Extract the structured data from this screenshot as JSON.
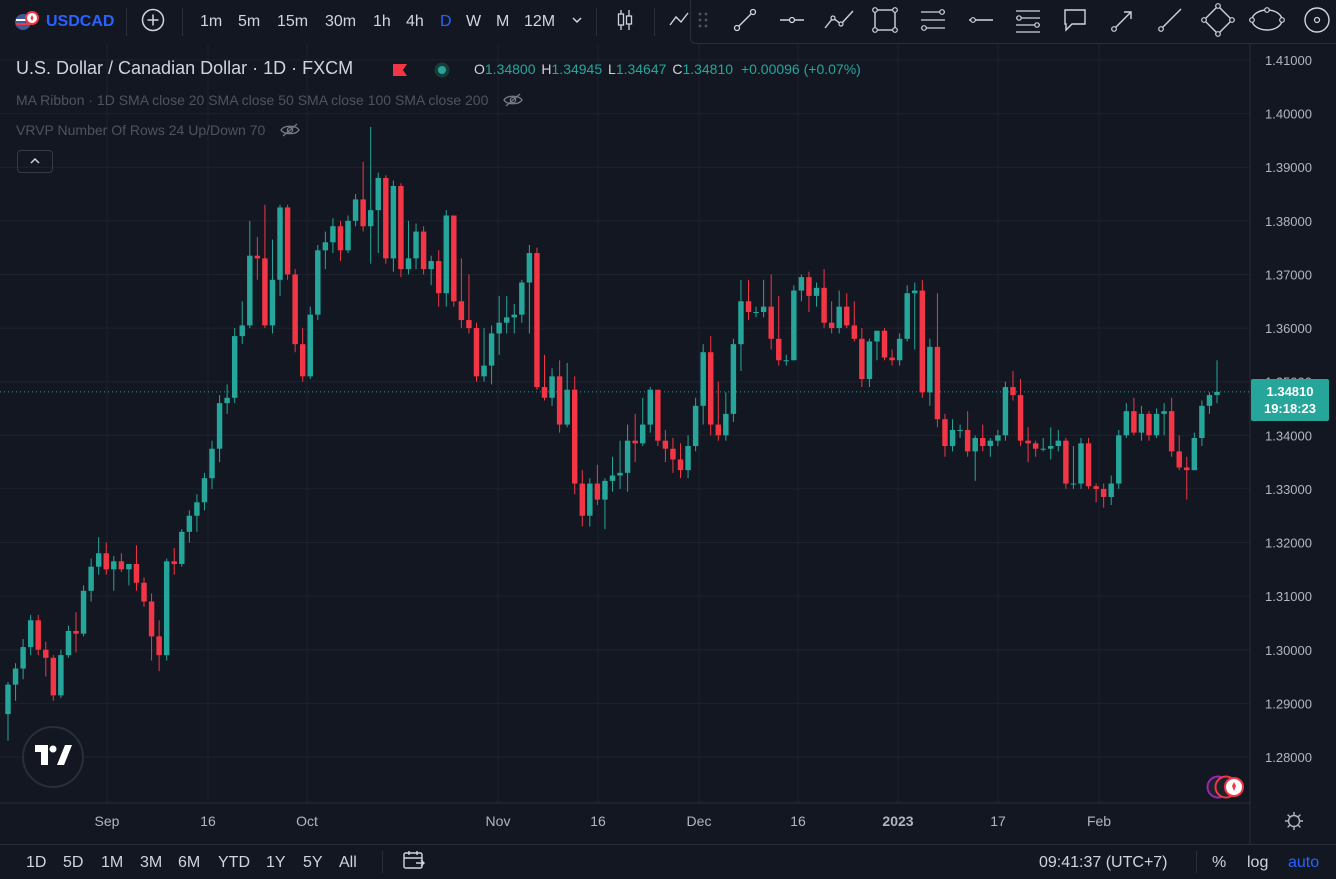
{
  "topbar": {
    "symbol": "USDCAD",
    "intervals": [
      "1m",
      "5m",
      "15m",
      "30m",
      "1h",
      "4h",
      "D",
      "W",
      "M",
      "12M"
    ],
    "active_interval": "D"
  },
  "legend": {
    "title": "U.S. Dollar / Canadian Dollar · 1D · FXCM",
    "o_label": "O",
    "o_value": "1.34800",
    "h_label": "H",
    "h_value": "1.34945",
    "l_label": "L",
    "l_value": "1.34647",
    "c_label": "C",
    "c_value": "1.34810",
    "change": "+0.00096 (+0.07%)",
    "indicators": [
      {
        "name": "MA Ribbon",
        "params": "· 1D SMA close 20 SMA close 50 SMA close 100 SMA close 200"
      },
      {
        "name": "VRVP",
        "params": "Number Of Rows 24 Up/Down 70"
      }
    ]
  },
  "price_axis": {
    "labels": [
      "1.41000",
      "1.40000",
      "1.39000",
      "1.38000",
      "1.37000",
      "1.36000",
      "1.35000",
      "1.34000",
      "1.33000",
      "1.32000",
      "1.31000",
      "1.30000",
      "1.29000",
      "1.28000"
    ],
    "current_price": "1.34810",
    "countdown": "19:18:23"
  },
  "time_axis": {
    "labels": [
      {
        "text": "Sep",
        "bold": false
      },
      {
        "text": "16",
        "bold": false
      },
      {
        "text": "Oct",
        "bold": false
      },
      {
        "text": "Nov",
        "bold": false
      },
      {
        "text": "16",
        "bold": false
      },
      {
        "text": "Dec",
        "bold": false
      },
      {
        "text": "16",
        "bold": false
      },
      {
        "text": "2023",
        "bold": true
      },
      {
        "text": "17",
        "bold": false
      },
      {
        "text": "Feb",
        "bold": false
      }
    ]
  },
  "bottombar": {
    "ranges": [
      "1D",
      "5D",
      "1M",
      "3M",
      "6M",
      "YTD",
      "1Y",
      "5Y",
      "All"
    ],
    "clock": "09:41:37 (UTC+7)",
    "percent_label": "%",
    "log_label": "log",
    "auto_label": "auto"
  },
  "colors": {
    "up": "#26a69a",
    "down": "#f23645",
    "accent": "#2962ff",
    "background": "#131722"
  },
  "chart_data": {
    "type": "candlestick",
    "symbol": "USDCAD",
    "interval": "1D",
    "ylim": [
      1.2715,
      1.4145
    ],
    "candles": [
      {
        "o": 1.288,
        "h": 1.294,
        "l": 1.283,
        "c": 1.2935
      },
      {
        "o": 1.2935,
        "h": 1.2975,
        "l": 1.2905,
        "c": 1.2965
      },
      {
        "o": 1.2965,
        "h": 1.302,
        "l": 1.2945,
        "c": 1.3005
      },
      {
        "o": 1.3005,
        "h": 1.3065,
        "l": 1.299,
        "c": 1.3055
      },
      {
        "o": 1.3055,
        "h": 1.3065,
        "l": 1.299,
        "c": 1.3
      },
      {
        "o": 1.3,
        "h": 1.3015,
        "l": 1.295,
        "c": 1.2985
      },
      {
        "o": 1.2985,
        "h": 1.299,
        "l": 1.2905,
        "c": 1.2915
      },
      {
        "o": 1.2915,
        "h": 1.3,
        "l": 1.291,
        "c": 1.299
      },
      {
        "o": 1.299,
        "h": 1.3045,
        "l": 1.2985,
        "c": 1.3035
      },
      {
        "o": 1.3035,
        "h": 1.307,
        "l": 1.2995,
        "c": 1.303
      },
      {
        "o": 1.303,
        "h": 1.312,
        "l": 1.3025,
        "c": 1.311
      },
      {
        "o": 1.311,
        "h": 1.317,
        "l": 1.309,
        "c": 1.3155
      },
      {
        "o": 1.3155,
        "h": 1.321,
        "l": 1.314,
        "c": 1.318
      },
      {
        "o": 1.318,
        "h": 1.32,
        "l": 1.314,
        "c": 1.315
      },
      {
        "o": 1.315,
        "h": 1.3175,
        "l": 1.311,
        "c": 1.3165
      },
      {
        "o": 1.3165,
        "h": 1.318,
        "l": 1.3145,
        "c": 1.315
      },
      {
        "o": 1.315,
        "h": 1.316,
        "l": 1.312,
        "c": 1.316
      },
      {
        "o": 1.316,
        "h": 1.3195,
        "l": 1.311,
        "c": 1.3125
      },
      {
        "o": 1.3125,
        "h": 1.3135,
        "l": 1.308,
        "c": 1.309
      },
      {
        "o": 1.309,
        "h": 1.3105,
        "l": 1.298,
        "c": 1.3025
      },
      {
        "o": 1.3025,
        "h": 1.3055,
        "l": 1.296,
        "c": 1.299
      },
      {
        "o": 1.299,
        "h": 1.317,
        "l": 1.298,
        "c": 1.3165
      },
      {
        "o": 1.3165,
        "h": 1.319,
        "l": 1.314,
        "c": 1.316
      },
      {
        "o": 1.316,
        "h": 1.3225,
        "l": 1.3155,
        "c": 1.322
      },
      {
        "o": 1.322,
        "h": 1.326,
        "l": 1.32,
        "c": 1.325
      },
      {
        "o": 1.325,
        "h": 1.329,
        "l": 1.322,
        "c": 1.3275
      },
      {
        "o": 1.3275,
        "h": 1.333,
        "l": 1.326,
        "c": 1.332
      },
      {
        "o": 1.332,
        "h": 1.339,
        "l": 1.33,
        "c": 1.3375
      },
      {
        "o": 1.3375,
        "h": 1.3475,
        "l": 1.335,
        "c": 1.346
      },
      {
        "o": 1.346,
        "h": 1.3495,
        "l": 1.344,
        "c": 1.347
      },
      {
        "o": 1.347,
        "h": 1.36,
        "l": 1.346,
        "c": 1.3585
      },
      {
        "o": 1.3585,
        "h": 1.365,
        "l": 1.357,
        "c": 1.3605
      },
      {
        "o": 1.3605,
        "h": 1.38,
        "l": 1.36,
        "c": 1.3735
      },
      {
        "o": 1.3735,
        "h": 1.377,
        "l": 1.369,
        "c": 1.373
      },
      {
        "o": 1.373,
        "h": 1.383,
        "l": 1.36,
        "c": 1.3605
      },
      {
        "o": 1.3605,
        "h": 1.3765,
        "l": 1.359,
        "c": 1.369
      },
      {
        "o": 1.369,
        "h": 1.383,
        "l": 1.366,
        "c": 1.3825
      },
      {
        "o": 1.3825,
        "h": 1.383,
        "l": 1.369,
        "c": 1.37
      },
      {
        "o": 1.37,
        "h": 1.371,
        "l": 1.3555,
        "c": 1.357
      },
      {
        "o": 1.357,
        "h": 1.36,
        "l": 1.35,
        "c": 1.351
      },
      {
        "o": 1.351,
        "h": 1.364,
        "l": 1.3505,
        "c": 1.3625
      },
      {
        "o": 1.3625,
        "h": 1.3755,
        "l": 1.3615,
        "c": 1.3745
      },
      {
        "o": 1.3745,
        "h": 1.378,
        "l": 1.371,
        "c": 1.376
      },
      {
        "o": 1.376,
        "h": 1.3805,
        "l": 1.374,
        "c": 1.379
      },
      {
        "o": 1.379,
        "h": 1.38,
        "l": 1.3725,
        "c": 1.3745
      },
      {
        "o": 1.3745,
        "h": 1.381,
        "l": 1.374,
        "c": 1.38
      },
      {
        "o": 1.38,
        "h": 1.385,
        "l": 1.379,
        "c": 1.384
      },
      {
        "o": 1.384,
        "h": 1.391,
        "l": 1.378,
        "c": 1.379
      },
      {
        "o": 1.379,
        "h": 1.3975,
        "l": 1.372,
        "c": 1.382
      },
      {
        "o": 1.382,
        "h": 1.389,
        "l": 1.374,
        "c": 1.388
      },
      {
        "o": 1.388,
        "h": 1.3885,
        "l": 1.372,
        "c": 1.373
      },
      {
        "o": 1.373,
        "h": 1.3875,
        "l": 1.3705,
        "c": 1.3865
      },
      {
        "o": 1.3865,
        "h": 1.387,
        "l": 1.3695,
        "c": 1.371
      },
      {
        "o": 1.371,
        "h": 1.38,
        "l": 1.37,
        "c": 1.373
      },
      {
        "o": 1.373,
        "h": 1.3795,
        "l": 1.371,
        "c": 1.378
      },
      {
        "o": 1.378,
        "h": 1.379,
        "l": 1.37,
        "c": 1.371
      },
      {
        "o": 1.371,
        "h": 1.3735,
        "l": 1.368,
        "c": 1.3725
      },
      {
        "o": 1.3725,
        "h": 1.3745,
        "l": 1.364,
        "c": 1.3665
      },
      {
        "o": 1.3665,
        "h": 1.382,
        "l": 1.364,
        "c": 1.381
      },
      {
        "o": 1.381,
        "h": 1.38,
        "l": 1.364,
        "c": 1.365
      },
      {
        "o": 1.365,
        "h": 1.373,
        "l": 1.36,
        "c": 1.3615
      },
      {
        "o": 1.3615,
        "h": 1.37,
        "l": 1.359,
        "c": 1.36
      },
      {
        "o": 1.36,
        "h": 1.361,
        "l": 1.35,
        "c": 1.351
      },
      {
        "o": 1.351,
        "h": 1.36,
        "l": 1.35,
        "c": 1.353
      },
      {
        "o": 1.353,
        "h": 1.3605,
        "l": 1.3495,
        "c": 1.359
      },
      {
        "o": 1.359,
        "h": 1.366,
        "l": 1.355,
        "c": 1.361
      },
      {
        "o": 1.361,
        "h": 1.366,
        "l": 1.359,
        "c": 1.362
      },
      {
        "o": 1.362,
        "h": 1.3645,
        "l": 1.359,
        "c": 1.3625
      },
      {
        "o": 1.3625,
        "h": 1.369,
        "l": 1.361,
        "c": 1.3685
      },
      {
        "o": 1.3685,
        "h": 1.3755,
        "l": 1.359,
        "c": 1.374
      },
      {
        "o": 1.374,
        "h": 1.375,
        "l": 1.3485,
        "c": 1.349
      },
      {
        "o": 1.349,
        "h": 1.355,
        "l": 1.3465,
        "c": 1.347
      },
      {
        "o": 1.347,
        "h": 1.3525,
        "l": 1.3455,
        "c": 1.351
      },
      {
        "o": 1.351,
        "h": 1.354,
        "l": 1.3405,
        "c": 1.342
      },
      {
        "o": 1.342,
        "h": 1.3535,
        "l": 1.3415,
        "c": 1.3485
      },
      {
        "o": 1.3485,
        "h": 1.351,
        "l": 1.329,
        "c": 1.331
      },
      {
        "o": 1.331,
        "h": 1.3335,
        "l": 1.323,
        "c": 1.325
      },
      {
        "o": 1.325,
        "h": 1.332,
        "l": 1.323,
        "c": 1.331
      },
      {
        "o": 1.331,
        "h": 1.3345,
        "l": 1.327,
        "c": 1.328
      },
      {
        "o": 1.328,
        "h": 1.332,
        "l": 1.3225,
        "c": 1.3315
      },
      {
        "o": 1.3315,
        "h": 1.336,
        "l": 1.3295,
        "c": 1.3325
      },
      {
        "o": 1.3325,
        "h": 1.339,
        "l": 1.33,
        "c": 1.333
      },
      {
        "o": 1.333,
        "h": 1.342,
        "l": 1.3295,
        "c": 1.339
      },
      {
        "o": 1.339,
        "h": 1.344,
        "l": 1.335,
        "c": 1.3385
      },
      {
        "o": 1.3385,
        "h": 1.347,
        "l": 1.338,
        "c": 1.342
      },
      {
        "o": 1.342,
        "h": 1.349,
        "l": 1.3405,
        "c": 1.3485
      },
      {
        "o": 1.3485,
        "h": 1.3485,
        "l": 1.338,
        "c": 1.339
      },
      {
        "o": 1.339,
        "h": 1.341,
        "l": 1.335,
        "c": 1.3375
      },
      {
        "o": 1.3375,
        "h": 1.3395,
        "l": 1.333,
        "c": 1.3355
      },
      {
        "o": 1.3355,
        "h": 1.3385,
        "l": 1.332,
        "c": 1.3335
      },
      {
        "o": 1.3335,
        "h": 1.34,
        "l": 1.332,
        "c": 1.338
      },
      {
        "o": 1.338,
        "h": 1.347,
        "l": 1.337,
        "c": 1.3455
      },
      {
        "o": 1.3455,
        "h": 1.357,
        "l": 1.342,
        "c": 1.3555
      },
      {
        "o": 1.3555,
        "h": 1.3585,
        "l": 1.34,
        "c": 1.342
      },
      {
        "o": 1.342,
        "h": 1.35,
        "l": 1.339,
        "c": 1.34
      },
      {
        "o": 1.34,
        "h": 1.348,
        "l": 1.339,
        "c": 1.344
      },
      {
        "o": 1.344,
        "h": 1.358,
        "l": 1.3425,
        "c": 1.357
      },
      {
        "o": 1.357,
        "h": 1.369,
        "l": 1.352,
        "c": 1.365
      },
      {
        "o": 1.365,
        "h": 1.369,
        "l": 1.3615,
        "c": 1.363
      },
      {
        "o": 1.363,
        "h": 1.364,
        "l": 1.362,
        "c": 1.363
      },
      {
        "o": 1.363,
        "h": 1.369,
        "l": 1.362,
        "c": 1.364
      },
      {
        "o": 1.364,
        "h": 1.37,
        "l": 1.356,
        "c": 1.358
      },
      {
        "o": 1.358,
        "h": 1.366,
        "l": 1.353,
        "c": 1.354
      },
      {
        "o": 1.354,
        "h": 1.355,
        "l": 1.353,
        "c": 1.354
      },
      {
        "o": 1.354,
        "h": 1.368,
        "l": 1.354,
        "c": 1.367
      },
      {
        "o": 1.367,
        "h": 1.37,
        "l": 1.365,
        "c": 1.3695
      },
      {
        "o": 1.3695,
        "h": 1.3705,
        "l": 1.363,
        "c": 1.366
      },
      {
        "o": 1.366,
        "h": 1.3685,
        "l": 1.364,
        "c": 1.3675
      },
      {
        "o": 1.3675,
        "h": 1.371,
        "l": 1.36,
        "c": 1.361
      },
      {
        "o": 1.361,
        "h": 1.365,
        "l": 1.359,
        "c": 1.36
      },
      {
        "o": 1.36,
        "h": 1.367,
        "l": 1.359,
        "c": 1.364
      },
      {
        "o": 1.364,
        "h": 1.3665,
        "l": 1.36,
        "c": 1.3605
      },
      {
        "o": 1.3605,
        "h": 1.365,
        "l": 1.3575,
        "c": 1.358
      },
      {
        "o": 1.358,
        "h": 1.36,
        "l": 1.349,
        "c": 1.3505
      },
      {
        "o": 1.3505,
        "h": 1.358,
        "l": 1.349,
        "c": 1.3575
      },
      {
        "o": 1.3575,
        "h": 1.359,
        "l": 1.354,
        "c": 1.3595
      },
      {
        "o": 1.3595,
        "h": 1.36,
        "l": 1.354,
        "c": 1.3545
      },
      {
        "o": 1.3545,
        "h": 1.356,
        "l": 1.353,
        "c": 1.354
      },
      {
        "o": 1.354,
        "h": 1.359,
        "l": 1.353,
        "c": 1.358
      },
      {
        "o": 1.358,
        "h": 1.368,
        "l": 1.3575,
        "c": 1.3665
      },
      {
        "o": 1.3665,
        "h": 1.3685,
        "l": 1.356,
        "c": 1.367
      },
      {
        "o": 1.367,
        "h": 1.369,
        "l": 1.347,
        "c": 1.348
      },
      {
        "o": 1.348,
        "h": 1.358,
        "l": 1.3455,
        "c": 1.3565
      },
      {
        "o": 1.3565,
        "h": 1.3665,
        "l": 1.3415,
        "c": 1.343
      },
      {
        "o": 1.343,
        "h": 1.344,
        "l": 1.336,
        "c": 1.338
      },
      {
        "o": 1.338,
        "h": 1.343,
        "l": 1.337,
        "c": 1.341
      },
      {
        "o": 1.341,
        "h": 1.342,
        "l": 1.3395,
        "c": 1.341
      },
      {
        "o": 1.341,
        "h": 1.3445,
        "l": 1.336,
        "c": 1.337
      },
      {
        "o": 1.337,
        "h": 1.34,
        "l": 1.3315,
        "c": 1.3395
      },
      {
        "o": 1.3395,
        "h": 1.342,
        "l": 1.337,
        "c": 1.338
      },
      {
        "o": 1.338,
        "h": 1.3395,
        "l": 1.336,
        "c": 1.339
      },
      {
        "o": 1.339,
        "h": 1.341,
        "l": 1.338,
        "c": 1.34
      },
      {
        "o": 1.34,
        "h": 1.35,
        "l": 1.339,
        "c": 1.349
      },
      {
        "o": 1.349,
        "h": 1.352,
        "l": 1.3465,
        "c": 1.3475
      },
      {
        "o": 1.3475,
        "h": 1.3505,
        "l": 1.338,
        "c": 1.339
      },
      {
        "o": 1.339,
        "h": 1.3415,
        "l": 1.335,
        "c": 1.3385
      },
      {
        "o": 1.3385,
        "h": 1.339,
        "l": 1.336,
        "c": 1.3375
      },
      {
        "o": 1.3375,
        "h": 1.3395,
        "l": 1.337,
        "c": 1.3375
      },
      {
        "o": 1.3375,
        "h": 1.3415,
        "l": 1.3355,
        "c": 1.338
      },
      {
        "o": 1.338,
        "h": 1.341,
        "l": 1.337,
        "c": 1.339
      },
      {
        "o": 1.339,
        "h": 1.3395,
        "l": 1.33,
        "c": 1.331
      },
      {
        "o": 1.331,
        "h": 1.338,
        "l": 1.33,
        "c": 1.331
      },
      {
        "o": 1.331,
        "h": 1.3395,
        "l": 1.33,
        "c": 1.3385
      },
      {
        "o": 1.3385,
        "h": 1.3395,
        "l": 1.33,
        "c": 1.3305
      },
      {
        "o": 1.3305,
        "h": 1.331,
        "l": 1.3275,
        "c": 1.33
      },
      {
        "o": 1.33,
        "h": 1.331,
        "l": 1.3265,
        "c": 1.3285
      },
      {
        "o": 1.3285,
        "h": 1.3325,
        "l": 1.327,
        "c": 1.331
      },
      {
        "o": 1.331,
        "h": 1.341,
        "l": 1.33,
        "c": 1.34
      },
      {
        "o": 1.34,
        "h": 1.346,
        "l": 1.3395,
        "c": 1.3445
      },
      {
        "o": 1.3445,
        "h": 1.347,
        "l": 1.34,
        "c": 1.3405
      },
      {
        "o": 1.3405,
        "h": 1.3455,
        "l": 1.339,
        "c": 1.344
      },
      {
        "o": 1.344,
        "h": 1.3445,
        "l": 1.339,
        "c": 1.34
      },
      {
        "o": 1.34,
        "h": 1.345,
        "l": 1.3395,
        "c": 1.344
      },
      {
        "o": 1.344,
        "h": 1.346,
        "l": 1.34,
        "c": 1.3445
      },
      {
        "o": 1.3445,
        "h": 1.347,
        "l": 1.336,
        "c": 1.337
      },
      {
        "o": 1.337,
        "h": 1.34,
        "l": 1.3335,
        "c": 1.334
      },
      {
        "o": 1.334,
        "h": 1.336,
        "l": 1.328,
        "c": 1.3335
      },
      {
        "o": 1.3335,
        "h": 1.3405,
        "l": 1.3335,
        "c": 1.3395
      },
      {
        "o": 1.3395,
        "h": 1.3465,
        "l": 1.338,
        "c": 1.3455
      },
      {
        "o": 1.3455,
        "h": 1.348,
        "l": 1.344,
        "c": 1.3475
      },
      {
        "o": 1.3475,
        "h": 1.354,
        "l": 1.346,
        "c": 1.3481
      }
    ]
  }
}
